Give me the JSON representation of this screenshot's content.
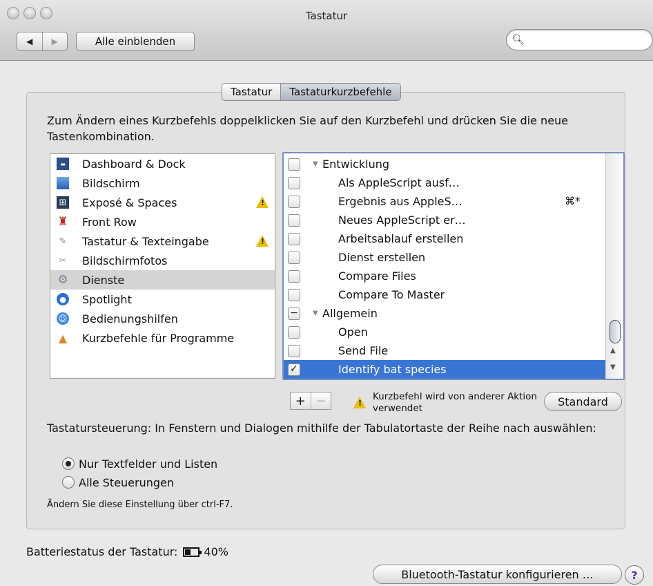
{
  "window": {
    "title": "Tastatur"
  },
  "toolbar": {
    "back_icon": "◀",
    "forward_icon": "▶",
    "show_all": "Alle einblenden",
    "search_placeholder": ""
  },
  "tabs": [
    {
      "label": "Tastatur",
      "active": false
    },
    {
      "label": "Tastaturkurzbefehle",
      "active": true
    }
  ],
  "intro": "Zum Ändern eines Kurzbefehls doppelklicken Sie auf den Kurzbefehl und drücken Sie die neue Tastenkombination.",
  "categories": [
    {
      "label": "Dashboard & Dock",
      "icon": "dashboard-icon",
      "warning": false,
      "selected": false
    },
    {
      "label": "Bildschirm",
      "icon": "display-icon",
      "warning": false,
      "selected": false
    },
    {
      "label": "Exposé & Spaces",
      "icon": "expose-icon",
      "warning": true,
      "selected": false
    },
    {
      "label": "Front Row",
      "icon": "front-row-icon",
      "warning": false,
      "selected": false
    },
    {
      "label": "Tastatur & Texteingabe",
      "icon": "keyboard-icon",
      "warning": true,
      "selected": false
    },
    {
      "label": "Bildschirmfotos",
      "icon": "screenshot-icon",
      "warning": false,
      "selected": false
    },
    {
      "label": "Dienste",
      "icon": "services-gear-icon",
      "warning": false,
      "selected": true
    },
    {
      "label": "Spotlight",
      "icon": "spotlight-icon",
      "warning": false,
      "selected": false
    },
    {
      "label": "Bedienungshilfen",
      "icon": "accessibility-icon",
      "warning": false,
      "selected": false
    },
    {
      "label": "Kurzbefehle für Programme",
      "icon": "app-shortcuts-icon",
      "warning": false,
      "selected": false
    }
  ],
  "shortcuts": [
    {
      "label": "Entwicklung",
      "group": true,
      "checked": "unchecked",
      "key": ""
    },
    {
      "label": "Als AppleScript ausf…",
      "group": false,
      "checked": "unchecked",
      "key": ""
    },
    {
      "label": "Ergebnis aus AppleS…",
      "group": false,
      "checked": "unchecked",
      "key": "⌘*"
    },
    {
      "label": "Neues AppleScript er…",
      "group": false,
      "checked": "unchecked",
      "key": ""
    },
    {
      "label": "Arbeitsablauf erstellen",
      "group": false,
      "checked": "unchecked",
      "key": ""
    },
    {
      "label": "Dienst erstellen",
      "group": false,
      "checked": "unchecked",
      "key": ""
    },
    {
      "label": "Compare Files",
      "group": false,
      "checked": "unchecked",
      "key": ""
    },
    {
      "label": "Compare To Master",
      "group": false,
      "checked": "unchecked",
      "key": ""
    },
    {
      "label": "Allgemein",
      "group": true,
      "checked": "mixed",
      "key": ""
    },
    {
      "label": "Open",
      "group": false,
      "checked": "unchecked",
      "key": ""
    },
    {
      "label": "Send File",
      "group": false,
      "checked": "unchecked",
      "key": ""
    },
    {
      "label": "Identify bat species",
      "group": false,
      "checked": "checked",
      "key": "",
      "selected": true
    }
  ],
  "buttons": {
    "add": "+",
    "remove": "−",
    "defaults": "Standard",
    "bluetooth": "Bluetooth-Tastatur konfigurieren …",
    "help": "?"
  },
  "in_use_note": "Kurzbefehl wird von anderer Aktion verwendet",
  "keyboard_nav": {
    "description": "Tastatursteuerung: In Fenstern und Dialogen mithilfe der Tabulatortaste der Reihe nach auswählen:",
    "options": [
      {
        "label": "Nur Textfelder und Listen",
        "selected": true
      },
      {
        "label": "Alle Steuerungen",
        "selected": false
      }
    ],
    "hint": "Ändern Sie diese Einstellung über ctrl-F7."
  },
  "battery": {
    "label": "Batteriestatus der Tastatur:",
    "level": "40%"
  },
  "colors": {
    "selection": "#3a75d5",
    "warning": "#e9bd00",
    "list_selection": "#d4d4d4"
  }
}
